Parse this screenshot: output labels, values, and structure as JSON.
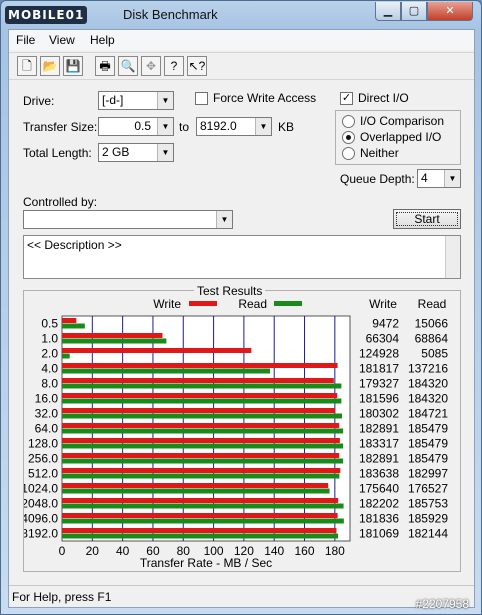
{
  "window": {
    "brand": "MOBILE01",
    "title": "Disk Benchmark",
    "close_label": "✕"
  },
  "menu": {
    "items": [
      "File",
      "View",
      "Help"
    ]
  },
  "toolbar": {
    "icons": [
      "new-icon",
      "open-icon",
      "save-icon",
      "print-icon",
      "print-preview-icon",
      "move-icon",
      "help-icon",
      "context-help-icon"
    ]
  },
  "settings": {
    "drive_label": "Drive:",
    "drive_value": "[-d-]",
    "force_write_label": "Force Write Access",
    "force_write_checked": false,
    "direct_io_label": "Direct I/O",
    "direct_io_checked": true,
    "transfer_size_label": "Transfer Size:",
    "transfer_from": "0.5",
    "to_label": "to",
    "transfer_to": "8192.0",
    "unit_label": "KB",
    "total_length_label": "Total Length:",
    "total_length": "2 GB",
    "io_options": [
      "I/O Comparison",
      "Overlapped I/O",
      "Neither"
    ],
    "io_selected": "Overlapped I/O",
    "queue_depth_label": "Queue Depth:",
    "queue_depth": "4",
    "controlled_by_label": "Controlled by:",
    "controlled_by_value": "",
    "start_label": "Start",
    "description": "<< Description >>"
  },
  "results": {
    "title": "Test Results",
    "legend_write": "Write",
    "legend_read": "Read",
    "col_write": "Write",
    "col_read": "Read",
    "xlabel": "Transfer Rate - MB / Sec",
    "colors": {
      "write": "#e01818",
      "read": "#1a8a1a",
      "grid": "#1a1aa0"
    }
  },
  "chart_data": {
    "type": "bar",
    "orientation": "horizontal",
    "categories": [
      "0.5",
      "1.0",
      "2.0",
      "4.0",
      "8.0",
      "16.0",
      "32.0",
      "64.0",
      "128.0",
      "256.0",
      "512.0",
      "1024.0",
      "2048.0",
      "4096.0",
      "8192.0"
    ],
    "series": [
      {
        "name": "Write",
        "values": [
          9472,
          66304,
          124928,
          181817,
          179327,
          181596,
          180302,
          182891,
          183317,
          182891,
          183638,
          175640,
          182202,
          181836,
          181069
        ]
      },
      {
        "name": "Read",
        "values": [
          15066,
          68864,
          5085,
          137216,
          184320,
          184320,
          184721,
          185479,
          185479,
          185479,
          182997,
          176527,
          185753,
          185929,
          182144
        ]
      }
    ],
    "bar_scale": {
      "units_per_mb": 1000
    },
    "xlabel": "Transfer Rate - MB / Sec",
    "xticks": [
      0,
      20,
      40,
      60,
      80,
      100,
      120,
      140,
      160,
      180
    ],
    "xlim": [
      0,
      190
    ],
    "grid": true
  },
  "status": {
    "text": "For Help, press F1"
  },
  "watermark": "#2207958"
}
